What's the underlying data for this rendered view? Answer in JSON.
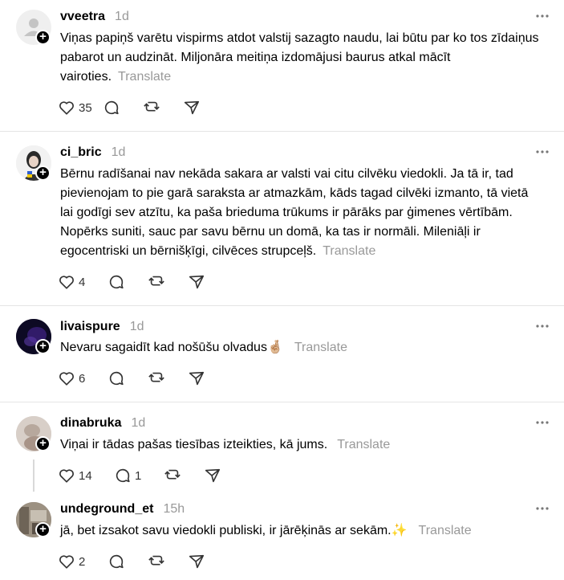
{
  "posts": [
    {
      "username": "vveetra",
      "time": "1d",
      "text": "Viņas papiņš varētu vispirms atdot valstij sazagto naudu, lai būtu par ko tos zīdaiņus pabarot un audzināt. Miljonāra meitiņa izdomājusi baurus atkal mācīt vairoties.",
      "translate": "Translate",
      "likes": "35",
      "replies": "",
      "avatar": "default-avatar"
    },
    {
      "username": "ci_bric",
      "time": "1d",
      "text": "Bērnu radīšanai nav nekāda sakara ar valsti vai citu cilvēku viedokli. Ja tā ir, tad pievienojam to pie garā saraksta ar atmazkām, kāds tagad cilvēki izmanto, tā vietā lai godīgi sev atzītu, ka paša brieduma trūkums ir pārāks par ģimenes vērtībām. Nopērks suniti, sauc par savu bērnu un domā, ka tas ir normāli. Mileniāļi ir egocentriski un bērnišķīgi, cilvēces strupceļš.",
      "translate": "Translate",
      "likes": "4",
      "replies": "",
      "avatar": "woman-photo"
    },
    {
      "username": "livaispure",
      "time": "1d",
      "text": "Nevaru sagaidīt kad nošūšu olvadus",
      "emoji": "🤞🏼",
      "translate": "Translate",
      "likes": "6",
      "replies": "",
      "avatar": "dark-purple-photo"
    },
    {
      "username": "dinabruka",
      "time": "1d",
      "text": "Viņai ir tādas pašas tiesības izteikties, kā jums.",
      "translate": "Translate",
      "likes": "14",
      "replies": "1",
      "avatar": "blurred-photo"
    },
    {
      "username": "undeground_et",
      "time": "15h",
      "text": "jā, bet izsakot savu viedokli publiski, ir jārēķinās ar sekām.",
      "emoji": "✨",
      "translate": "Translate",
      "likes": "2",
      "replies": "",
      "avatar": "room-photo"
    }
  ],
  "icons": {
    "like": "heart-icon",
    "reply": "comment-icon",
    "repost": "repost-icon",
    "share": "send-icon",
    "more": "more-icon",
    "follow": "plus-icon"
  }
}
